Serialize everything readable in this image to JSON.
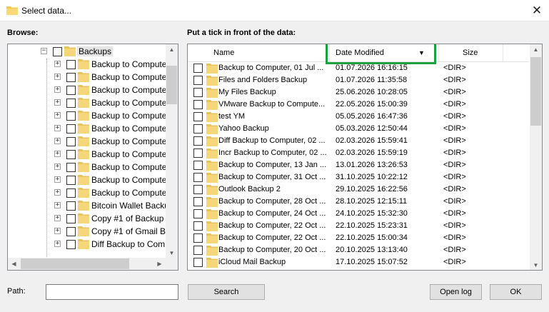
{
  "window": {
    "title": "Select data..."
  },
  "browse_label": "Browse:",
  "tick_label": "Put a tick in front of the data:",
  "tree": {
    "root": {
      "label": "Backups"
    },
    "items": [
      "Backup to Compute",
      "Backup to Compute",
      "Backup to Compute",
      "Backup to Compute",
      "Backup to Compute",
      "Backup to Compute",
      "Backup to Compute",
      "Backup to Compute",
      "Backup to Compute",
      "Backup to Compute",
      "Backup to Compute",
      "Bitcoin Wallet Backu",
      "Copy #1 of Backup",
      "Copy #1 of Gmail B",
      "Diff Backup to Com"
    ]
  },
  "list": {
    "columns": {
      "name": "Name",
      "date": "Date Modified",
      "size": "Size"
    },
    "rows": [
      {
        "name": "Backup to Computer, 01 Jul ...",
        "date": "01.07.2026 16:16:15",
        "size": "<DIR>"
      },
      {
        "name": "Files and Folders Backup",
        "date": "01.07.2026 11:35:58",
        "size": "<DIR>"
      },
      {
        "name": "My Files Backup",
        "date": "25.06.2026 10:28:05",
        "size": "<DIR>"
      },
      {
        "name": "VMware Backup to Compute...",
        "date": "22.05.2026 15:00:39",
        "size": "<DIR>"
      },
      {
        "name": "test YM",
        "date": "05.05.2026 16:47:36",
        "size": "<DIR>"
      },
      {
        "name": "Yahoo Backup",
        "date": "05.03.2026 12:50:44",
        "size": "<DIR>"
      },
      {
        "name": "Diff Backup to Computer, 02 ...",
        "date": "02.03.2026 15:59:41",
        "size": "<DIR>"
      },
      {
        "name": "Incr Backup to Computer, 02 ...",
        "date": "02.03.2026 15:59:19",
        "size": "<DIR>"
      },
      {
        "name": "Backup to Computer, 13 Jan ...",
        "date": "13.01.2026 13:26:53",
        "size": "<DIR>"
      },
      {
        "name": "Backup to Computer, 31 Oct ...",
        "date": "31.10.2025 10:22:12",
        "size": "<DIR>"
      },
      {
        "name": "Outlook Backup 2",
        "date": "29.10.2025 16:22:56",
        "size": "<DIR>"
      },
      {
        "name": "Backup to Computer, 28 Oct ...",
        "date": "28.10.2025 12:15:11",
        "size": "<DIR>"
      },
      {
        "name": "Backup to Computer, 24 Oct ...",
        "date": "24.10.2025 15:32:30",
        "size": "<DIR>"
      },
      {
        "name": "Backup to Computer, 22 Oct ...",
        "date": "22.10.2025 15:23:31",
        "size": "<DIR>"
      },
      {
        "name": "Backup to Computer, 22 Oct ...",
        "date": "22.10.2025 15:00:34",
        "size": "<DIR>"
      },
      {
        "name": "Backup to Computer, 20 Oct ...",
        "date": "20.10.2025 13:13:40",
        "size": "<DIR>"
      },
      {
        "name": "iCloud Mail Backup",
        "date": "17.10.2025 15:07:52",
        "size": "<DIR>"
      }
    ]
  },
  "path": {
    "label": "Path:",
    "value": ""
  },
  "buttons": {
    "search": "Search",
    "open_log": "Open log",
    "ok": "OK"
  },
  "icons": {
    "title": "folder-icon",
    "close": "close-icon",
    "sort": "sort-descending-icon"
  },
  "colors": {
    "folder": "#f6d67a",
    "highlight": "#1ea03a"
  }
}
